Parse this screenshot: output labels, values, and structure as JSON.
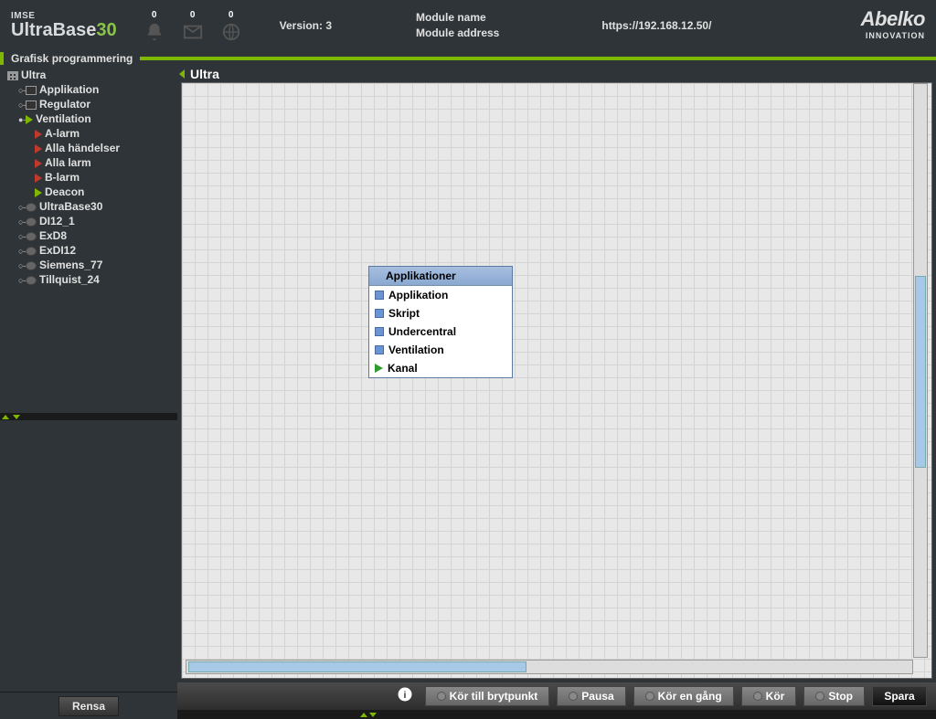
{
  "header": {
    "brand_small": "IMSE",
    "brand_big": "UltraBase",
    "brand_num": "30",
    "counts": {
      "bell": "0",
      "envelope": "0",
      "globe": "0"
    },
    "version_label": "Version: 3",
    "module_name_label": "Module name",
    "module_address_label": "Module address",
    "url": "https://192.168.12.50/",
    "logo_main": "Abelko",
    "logo_sub": "INNOVATION"
  },
  "greenbar": {
    "title": "Grafisk programmering"
  },
  "tree": {
    "root": "Ultra",
    "items": [
      {
        "label": "Applikation",
        "icon": "box",
        "toggle": "○"
      },
      {
        "label": "Regulator",
        "icon": "box",
        "toggle": "○"
      },
      {
        "label": "Ventilation",
        "icon": "play",
        "toggle": "●"
      }
    ],
    "ventilation_children": [
      {
        "label": "A-larm",
        "icon": "flag"
      },
      {
        "label": "Alla händelser",
        "icon": "flag"
      },
      {
        "label": "Alla larm",
        "icon": "flag"
      },
      {
        "label": "B-larm",
        "icon": "flag"
      },
      {
        "label": "Deacon",
        "icon": "arrow"
      }
    ],
    "devices": [
      {
        "label": "UltraBase30"
      },
      {
        "label": "DI12_1"
      },
      {
        "label": "ExD8"
      },
      {
        "label": "ExDI12"
      },
      {
        "label": "Siemens_77"
      },
      {
        "label": "Tillquist_24"
      }
    ]
  },
  "canvas": {
    "title": "Ultra"
  },
  "popup": {
    "header": "Applikationer",
    "items": [
      {
        "label": "Applikation",
        "type": "app"
      },
      {
        "label": "Skript",
        "type": "app"
      },
      {
        "label": "Undercentral",
        "type": "app"
      },
      {
        "label": "Ventilation",
        "type": "app"
      },
      {
        "label": "Kanal",
        "type": "channel"
      }
    ]
  },
  "bottombar": {
    "run_to_breakpoint": "Kör till brytpunkt",
    "pause": "Pausa",
    "run_once": "Kör en gång",
    "run": "Kör",
    "stop": "Stop",
    "save": "Spara"
  },
  "left_footer": {
    "clear": "Rensa"
  }
}
